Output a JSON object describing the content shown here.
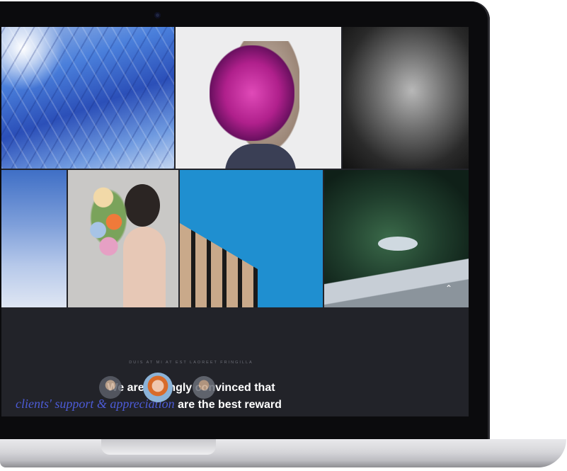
{
  "testimonials": {
    "eyebrow": "DUIS AT MI AT EST LAOREET FRINGILLA",
    "headline_line1": "We are strongly convinced that",
    "headline_accent": "clients' support & appreciation",
    "headline_line2_rest": " are the best reward"
  },
  "icons": {
    "scroll_up": "chevron-up-icon"
  }
}
